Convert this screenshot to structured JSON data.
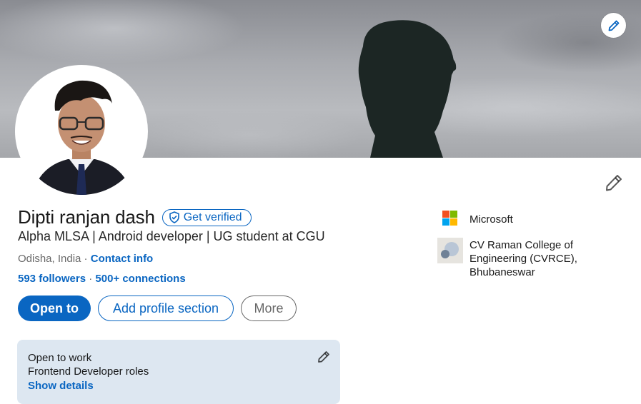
{
  "profile": {
    "name": "Dipti ranjan dash",
    "verified_label": "Get verified",
    "headline": "Alpha MLSA | Android developer | UG student at CGU",
    "location": "Odisha, India",
    "separator": " · ",
    "contact_info": "Contact info",
    "followers": "593 followers",
    "connections": "500+ connections"
  },
  "actions": {
    "open_to": "Open to",
    "add_section": "Add profile section",
    "more": "More"
  },
  "open_to_work": {
    "title": "Open to work",
    "roles": "Frontend Developer roles",
    "details": "Show details"
  },
  "experience": {
    "company": "Microsoft",
    "education": "CV Raman College of Engineering (CVRCE), Bhubaneswar"
  },
  "colors": {
    "accent": "#0a66c2",
    "open_to_work_bg": "#dde7f1"
  },
  "icons": [
    "pencil-icon",
    "shield-check-icon",
    "microsoft-logo",
    "college-logo"
  ]
}
